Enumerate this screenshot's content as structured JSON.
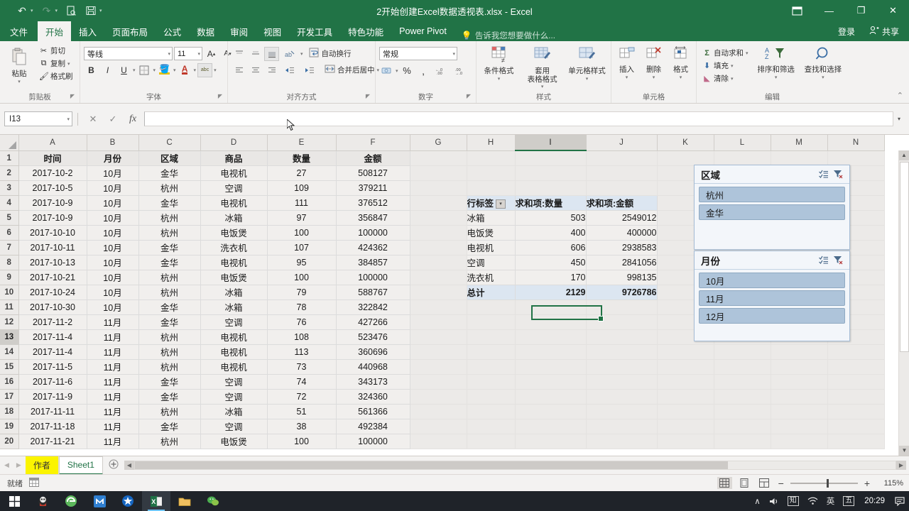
{
  "window": {
    "title": "2开始创建Excel数据透视表.xlsx - Excel",
    "qat": [
      {
        "name": "undo",
        "glyph": "↶"
      },
      {
        "name": "redo",
        "glyph": "↷"
      },
      {
        "name": "print-preview",
        "glyph": "🔍"
      },
      {
        "name": "save",
        "glyph": "💾"
      },
      {
        "name": "customize",
        "glyph": "▾"
      }
    ],
    "controls": {
      "ribbon_display": "▭",
      "minimize": "—",
      "restore": "❐",
      "close": "✕"
    }
  },
  "tabs": {
    "items": [
      "文件",
      "开始",
      "插入",
      "页面布局",
      "公式",
      "数据",
      "审阅",
      "视图",
      "开发工具",
      "特色功能",
      "Power Pivot"
    ],
    "active": "开始",
    "tellme": "告诉我您想要做什么...",
    "signin": "登录",
    "share": "共享"
  },
  "ribbon": {
    "clipboard": {
      "label": "剪贴板",
      "paste": "粘贴",
      "cut": "剪切",
      "copy": "复制",
      "format_painter": "格式刷"
    },
    "font": {
      "label": "字体",
      "font_name": "等线",
      "font_size": "11",
      "grow": "A",
      "shrink": "A",
      "bold": "B",
      "italic": "I",
      "underline": "U",
      "borders": "▦",
      "fill_color": "A",
      "font_color": "A",
      "highlight": "abc"
    },
    "alignment": {
      "label": "对齐方式",
      "wrap_text": "自动换行",
      "merge_center": "合并后居中"
    },
    "number": {
      "label": "数字",
      "format": "常规",
      "percent": "%",
      "comma": ",",
      "inc_dec": ".00",
      "dec_dec": ".00"
    },
    "styles": {
      "label": "样式",
      "conditional": "条件格式",
      "table_format": "套用\n表格格式",
      "cell_styles": "单元格样式"
    },
    "cells": {
      "label": "单元格",
      "insert": "插入",
      "delete": "删除",
      "format": "格式"
    },
    "editing": {
      "label": "编辑",
      "autosum": "自动求和",
      "fill": "填充",
      "clear": "清除",
      "sort_filter": "排序和筛选",
      "find_select": "查找和选择"
    }
  },
  "formula_bar": {
    "name_box": "I13",
    "cancel": "✕",
    "confirm": "✓",
    "fx": "fx",
    "value": ""
  },
  "sheet": {
    "columns": [
      "A",
      "B",
      "C",
      "D",
      "E",
      "F",
      "G",
      "H",
      "I",
      "J",
      "K",
      "L",
      "M",
      "N"
    ],
    "selected_column": "I",
    "selected_cell": "I13",
    "rows": [
      1,
      2,
      3,
      4,
      5,
      6,
      7,
      8,
      9,
      10,
      11,
      12,
      13,
      14,
      15,
      16,
      17,
      18,
      19,
      20
    ],
    "headers": [
      "时间",
      "月份",
      "区域",
      "商品",
      "数量",
      "金额"
    ],
    "data": [
      [
        "2017-10-2",
        "10月",
        "金华",
        "电视机",
        "27",
        "508127"
      ],
      [
        "2017-10-5",
        "10月",
        "杭州",
        "空调",
        "109",
        "379211"
      ],
      [
        "2017-10-9",
        "10月",
        "金华",
        "电视机",
        "111",
        "376512"
      ],
      [
        "2017-10-9",
        "10月",
        "杭州",
        "冰箱",
        "97",
        "356847"
      ],
      [
        "2017-10-10",
        "10月",
        "杭州",
        "电饭煲",
        "100",
        "100000"
      ],
      [
        "2017-10-11",
        "10月",
        "金华",
        "洗衣机",
        "107",
        "424362"
      ],
      [
        "2017-10-13",
        "10月",
        "金华",
        "电视机",
        "95",
        "384857"
      ],
      [
        "2017-10-21",
        "10月",
        "杭州",
        "电饭煲",
        "100",
        "100000"
      ],
      [
        "2017-10-24",
        "10月",
        "杭州",
        "冰箱",
        "79",
        "588767"
      ],
      [
        "2017-10-30",
        "10月",
        "金华",
        "冰箱",
        "78",
        "322842"
      ],
      [
        "2017-11-2",
        "11月",
        "金华",
        "空调",
        "76",
        "427266"
      ],
      [
        "2017-11-4",
        "11月",
        "杭州",
        "电视机",
        "108",
        "523476"
      ],
      [
        "2017-11-4",
        "11月",
        "杭州",
        "电视机",
        "113",
        "360696"
      ],
      [
        "2017-11-5",
        "11月",
        "杭州",
        "电视机",
        "73",
        "440968"
      ],
      [
        "2017-11-6",
        "11月",
        "金华",
        "空调",
        "74",
        "343173"
      ],
      [
        "2017-11-9",
        "11月",
        "金华",
        "空调",
        "72",
        "324360"
      ],
      [
        "2017-11-11",
        "11月",
        "杭州",
        "冰箱",
        "51",
        "561366"
      ],
      [
        "2017-11-18",
        "11月",
        "金华",
        "空调",
        "38",
        "492384"
      ],
      [
        "2017-11-21",
        "11月",
        "杭州",
        "电饭煲",
        "100",
        "100000"
      ]
    ]
  },
  "pivot": {
    "header": [
      "行标签",
      "求和项:数量",
      "求和项:金额"
    ],
    "rows": [
      [
        "冰箱",
        "503",
        "2549012"
      ],
      [
        "电饭煲",
        "400",
        "400000"
      ],
      [
        "电视机",
        "606",
        "2938583"
      ],
      [
        "空调",
        "450",
        "2841056"
      ],
      [
        "洗衣机",
        "170",
        "998135"
      ]
    ],
    "total": [
      "总计",
      "2129",
      "9726786"
    ]
  },
  "slicers": [
    {
      "title": "区域",
      "items": [
        "杭州",
        "金华"
      ],
      "multi_icon": "≔",
      "clear_icon": "▽"
    },
    {
      "title": "月份",
      "items": [
        "10月",
        "11月",
        "12月"
      ],
      "multi_icon": "≔",
      "clear_icon": "▽"
    }
  ],
  "sheet_tabs": {
    "items": [
      {
        "label": "作者",
        "state": "highlight"
      },
      {
        "label": "Sheet1",
        "state": "active"
      }
    ],
    "add": "＋"
  },
  "status_bar": {
    "ready": "就绪",
    "views": [
      "▦",
      "▤",
      "▥"
    ],
    "zoom": "115%",
    "zoom_out": "−",
    "zoom_in": "+"
  },
  "taskbar": {
    "start": "⊞",
    "apps": [
      "qq-icon",
      "browser-icon",
      "maxthon-icon",
      "star-icon",
      "excel-icon",
      "folder-icon",
      "wechat-icon"
    ],
    "tray": [
      "▲",
      "知",
      "📶",
      "英",
      "五"
    ],
    "clock": "20:29",
    "notify": "💬"
  }
}
